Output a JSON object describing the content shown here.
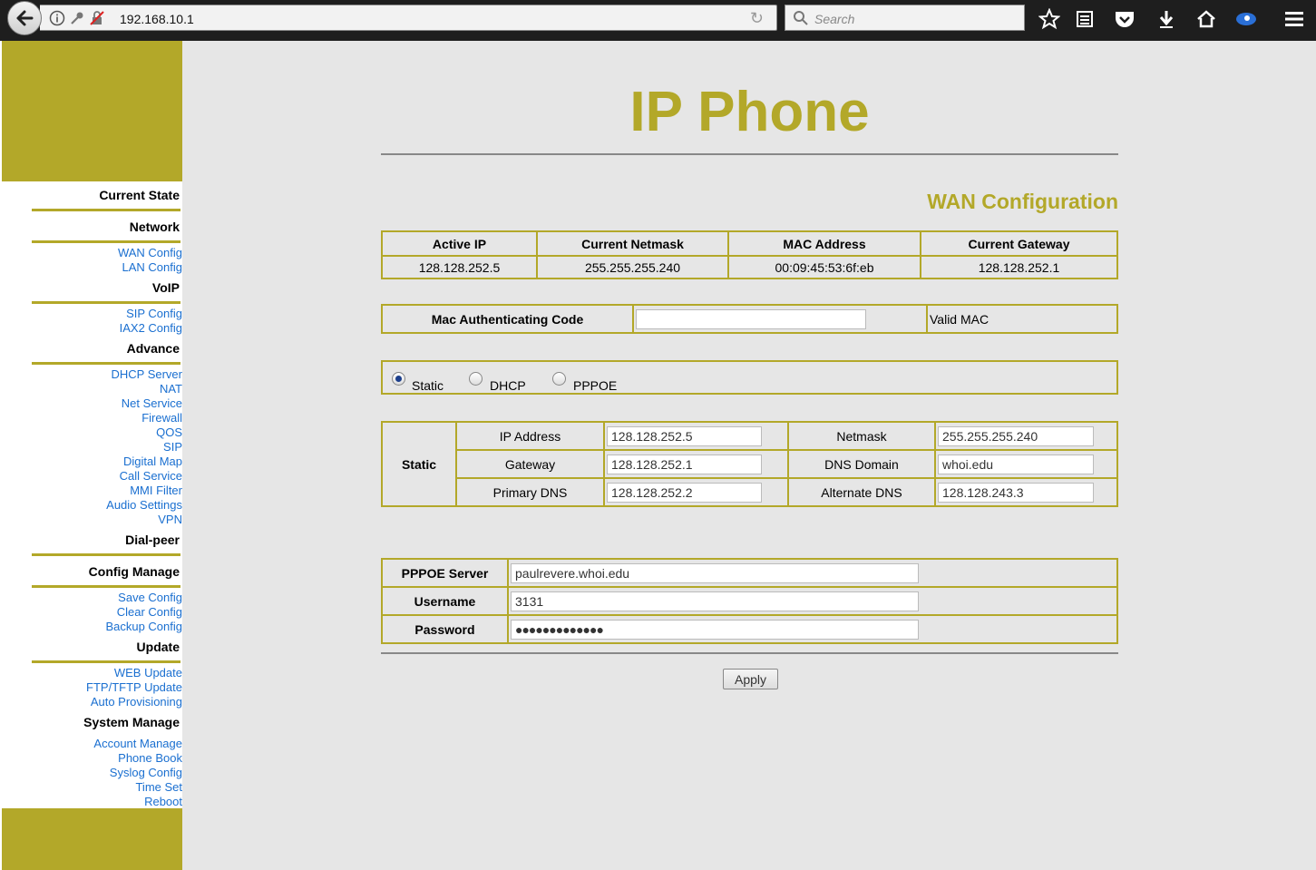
{
  "browser": {
    "url": "192.168.10.1",
    "search_placeholder": "Search"
  },
  "sidebar": {
    "sections": [
      {
        "title": "Current State"
      },
      {
        "title": "Network",
        "links": [
          "WAN Config",
          "LAN Config"
        ]
      },
      {
        "title": "VoIP",
        "links": [
          "SIP Config",
          "IAX2 Config"
        ]
      },
      {
        "title": "Advance",
        "links": [
          "DHCP Server",
          "NAT",
          "Net Service",
          "Firewall",
          "QOS",
          "SIP",
          "Digital Map",
          "Call Service",
          "MMI Filter",
          "Audio Settings",
          "VPN"
        ]
      },
      {
        "title": "Dial-peer"
      },
      {
        "title": "Config Manage",
        "links": [
          "Save Config",
          "Clear Config",
          "Backup Config"
        ]
      },
      {
        "title": "Update",
        "links": [
          "WEB Update",
          "FTP/TFTP Update",
          "Auto Provisioning"
        ]
      },
      {
        "title": "System Manage",
        "links": [
          "Account Manage",
          "Phone Book",
          "Syslog Config",
          "Time Set",
          "Reboot"
        ]
      }
    ]
  },
  "page": {
    "title": "IP Phone",
    "section": "WAN Configuration"
  },
  "status_table": {
    "headers": [
      "Active IP",
      "Current Netmask",
      "MAC Address",
      "Current Gateway"
    ],
    "values": [
      "128.128.252.5",
      "255.255.255.240",
      "00:09:45:53:6f:eb",
      "128.128.252.1"
    ]
  },
  "mac_auth": {
    "label": "Mac Authenticating Code",
    "value": "",
    "status": "Valid MAC"
  },
  "mode": {
    "options": [
      "Static",
      "DHCP",
      "PPPOE"
    ],
    "selected": "Static"
  },
  "static": {
    "label": "Static",
    "ip_label": "IP Address",
    "ip_value": "128.128.252.5",
    "netmask_label": "Netmask",
    "netmask_value": "255.255.255.240",
    "gateway_label": "Gateway",
    "gateway_value": "128.128.252.1",
    "dns_domain_label": "DNS Domain",
    "dns_domain_value": "whoi.edu",
    "primary_dns_label": "Primary DNS",
    "primary_dns_value": "128.128.252.2",
    "alt_dns_label": "Alternate DNS",
    "alt_dns_value": "128.128.243.3"
  },
  "pppoe": {
    "server_label": "PPPOE Server",
    "server_value": "paulrevere.whoi.edu",
    "username_label": "Username",
    "username_value": "3131",
    "password_label": "Password",
    "password_value": "●●●●●●●●●●●●●"
  },
  "apply_label": "Apply",
  "colors": {
    "accent": "#b3a829",
    "link": "#1a6fd0"
  }
}
